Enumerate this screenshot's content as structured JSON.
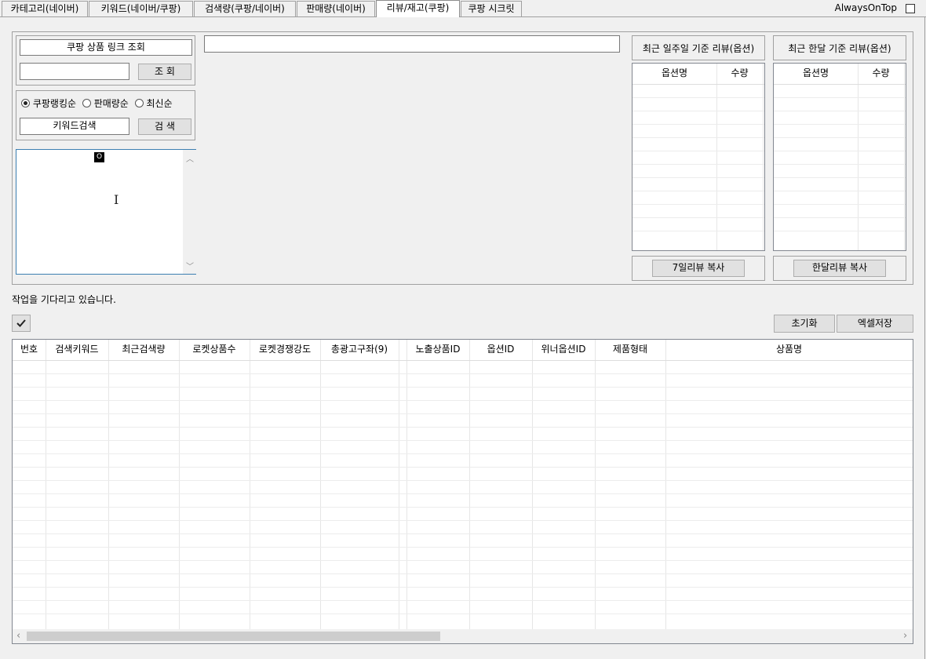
{
  "tabs": [
    {
      "label": "카테고리(네이버)",
      "active": false
    },
    {
      "label": "키워드(네이버/쿠팡)",
      "active": false
    },
    {
      "label": "검색량(쿠팡/네이버)",
      "active": false
    },
    {
      "label": "판매량(네이버)",
      "active": false
    },
    {
      "label": "리뷰/재고(쿠팡)",
      "active": true
    },
    {
      "label": "쿠팡 시크릿",
      "active": false
    }
  ],
  "always_on_top": {
    "label": "AlwaysOnTop",
    "checked": false
  },
  "lookup": {
    "title": "쿠팡 상품 링크 조회",
    "input_value": "",
    "button": "조 회"
  },
  "search": {
    "sort_options": [
      {
        "label": "쿠팡랭킹순",
        "selected": true
      },
      {
        "label": "판매량순",
        "selected": false
      },
      {
        "label": "최신순",
        "selected": false
      }
    ],
    "keyword_label": "키워드검색",
    "button": "검 색"
  },
  "text_area": {
    "cursor_char": "O"
  },
  "url_input": {
    "value": ""
  },
  "weekly_review": {
    "title": "최근 일주일 기준 리뷰(옵션)",
    "columns": [
      "옵션명",
      "수량"
    ],
    "copy_button": "7일리뷰 복사"
  },
  "monthly_review": {
    "title": "최근 한달 기준 리뷰(옵션)",
    "columns": [
      "옵션명",
      "수량"
    ],
    "copy_button": "한달리뷰 복사"
  },
  "status_text": "작업을 기다리고 있습니다.",
  "check_button_icon": "checkmark-icon",
  "actions": {
    "reset": "초기화",
    "excel": "엑셀저장"
  },
  "results_table": {
    "columns": [
      "번호",
      "검색키워드",
      "최근검색량",
      "로켓상품수",
      "로켓경쟁강도",
      "총광고구좌(9)",
      "",
      "노출상품ID",
      "옵션ID",
      "위너옵션ID",
      "제품형태",
      "상품명"
    ]
  }
}
